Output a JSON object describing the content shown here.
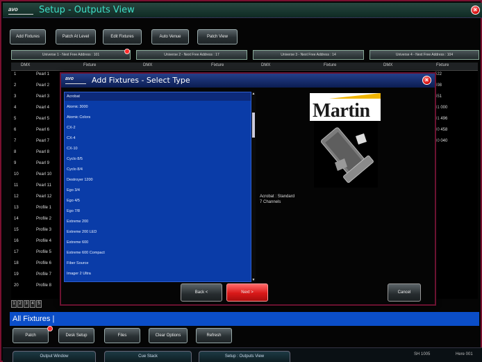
{
  "window": {
    "title": "Setup - Outputs View",
    "logo": "avo"
  },
  "toolbar": {
    "add_fixtures": "Add Fixtures",
    "patch_at_level": "Patch At Level",
    "edit_fixtures": "Edit Fixtures",
    "auto_venue": "Auto Venue",
    "patch_view": "Patch View"
  },
  "universes": [
    "Universe 1 - Next Free Address : 101",
    "Universe 2 - Next Free Address : 17",
    "Universe 3 - Next Free Address : 14",
    "Universe 4 - Next Free Address : 104"
  ],
  "grid": {
    "headers": [
      "DMX",
      "Fixture",
      "DMX",
      "Fixture",
      "DMX",
      "Fixture",
      "DMX",
      "Fixture"
    ],
    "rows": [
      {
        "num": "1",
        "name": "Pearl 1"
      },
      {
        "num": "2",
        "name": "Pearl 2"
      },
      {
        "num": "3",
        "name": "Pearl 3"
      },
      {
        "num": "4",
        "name": "Pearl 4"
      },
      {
        "num": "5",
        "name": "Pearl 5"
      },
      {
        "num": "6",
        "name": "Pearl 6"
      },
      {
        "num": "7",
        "name": "Pearl 7"
      },
      {
        "num": "8",
        "name": "Pearl 8"
      },
      {
        "num": "9",
        "name": "Pearl 9"
      },
      {
        "num": "10",
        "name": "Pearl 10"
      },
      {
        "num": "11",
        "name": "Pearl 11"
      },
      {
        "num": "12",
        "name": "Pearl 12"
      },
      {
        "num": "13",
        "name": "Profile 1"
      },
      {
        "num": "14",
        "name": "Profile 2"
      },
      {
        "num": "15",
        "name": "Profile 3"
      },
      {
        "num": "16",
        "name": "Profile 4"
      },
      {
        "num": "17",
        "name": "Profile 5"
      },
      {
        "num": "18",
        "name": "Profile 6"
      },
      {
        "num": "19",
        "name": "Profile 7"
      },
      {
        "num": "20",
        "name": "Profile 8"
      }
    ],
    "right_col": [
      "522",
      "498",
      "451",
      "31 000",
      "31 496",
      "30 458",
      "30 040"
    ]
  },
  "pager": [
    "1",
    "2",
    "3",
    "4",
    "5"
  ],
  "command_line": "All Fixtures |",
  "bottom_buttons": {
    "patch": "Patch",
    "desk_setup": "Desk Setup",
    "files": "Files",
    "clear_options": "Clear Options",
    "refresh": "Refresh"
  },
  "status_tabs": [
    "Output Window",
    "Cue Stack",
    "Setup : Outputs View"
  ],
  "status_info": {
    "left": "SH 1005",
    "right": "Here 001"
  },
  "dialog": {
    "title": "Add Fixtures - Select Type",
    "logo": "avo",
    "items": [
      "Acrobat",
      "Atomic 3000",
      "Atomic Colors",
      "CX-2",
      "CX-4",
      "CX-10",
      "Cyclo 8/5",
      "Cyclo 8/4",
      "Destroyer 1200",
      "Ego 3/4",
      "Ego 4/5",
      "Ego 7/8",
      "Extreme 200",
      "Extreme 200 LED",
      "Extreme 600",
      "Extreme 600 Compact",
      "Fiber Source",
      "Imager 2 Ultra"
    ],
    "brand": "Martin",
    "description_line1": "Acrobat : Standard",
    "description_line2": "7 Channels",
    "back": "Back <",
    "next": "Next >",
    "cancel": "Cancel"
  },
  "colors": {
    "accent_blue": "#0a3ca8",
    "command_blue": "#0b4ec8",
    "alert_red": "#d81818",
    "frame": "#7a1030",
    "title_cyan": "#3fe0c8"
  }
}
